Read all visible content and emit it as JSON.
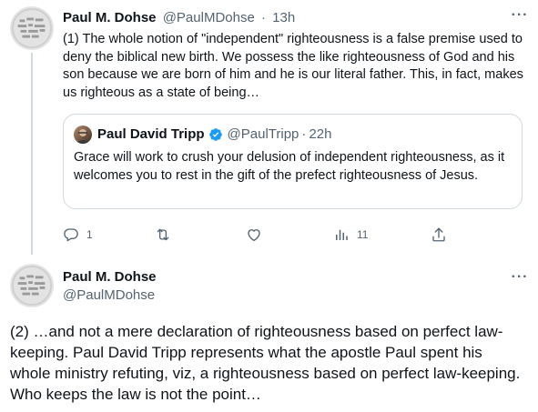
{
  "tweet1": {
    "author_name": "Paul M. Dohse",
    "author_handle": "@PaulMDohse",
    "separator": "·",
    "time": "13h",
    "more_label": "···",
    "text": "(1) The whole notion of \"independent\" righteousness is a false premise used to deny the biblical new birth. We possess the like righteousness of God and his son because we are born of him and he is our literal father. This, in fact, makes us righteous as a state of being…",
    "quote": {
      "author_name": "Paul David Tripp",
      "author_handle": "@PaulTripp",
      "separator": "·",
      "time": "22h",
      "text": "Grace will work to crush your delusion of independent righteousness, as it welcomes you to rest in the gift of the prefect righteousness of Jesus."
    },
    "actions": {
      "reply_count": "1",
      "retweet_count": "",
      "like_count": "",
      "views_count": "11",
      "icons": [
        "reply-icon",
        "retweet-icon",
        "like-icon",
        "views-icon",
        "share-icon"
      ]
    }
  },
  "tweet2": {
    "author_name": "Paul M. Dohse",
    "author_handle": "@PaulMDohse",
    "more_label": "···",
    "text": "(2) …and not a mere declaration of righteousness based on perfect law-keeping. Paul David Tripp represents what the apostle Paul spent his whole ministry refuting, viz, a righteousness based on perfect law-keeping. Who keeps the law is not the point…"
  },
  "colors": {
    "text_primary": "#0f1419",
    "text_secondary": "#536471",
    "border": "#cfd9de",
    "verified_blue": "#1d9bf0"
  }
}
